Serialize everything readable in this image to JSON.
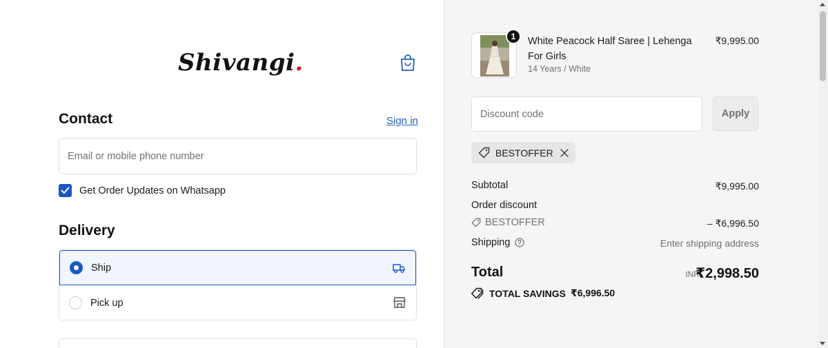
{
  "brand": {
    "name": "Shivangi"
  },
  "contact": {
    "title": "Contact",
    "signin_label": "Sign in",
    "email_placeholder": "Email or mobile phone number",
    "whatsapp_label": "Get Order Updates on Whatsapp",
    "whatsapp_checked": true
  },
  "delivery": {
    "title": "Delivery",
    "options": [
      {
        "label": "Ship",
        "selected": true,
        "icon": "truck-icon"
      },
      {
        "label": "Pick up",
        "selected": false,
        "icon": "store-icon"
      }
    ]
  },
  "cart": {
    "item": {
      "name": "White Peacock Half Saree | Lehenga For Girls",
      "variant": "14 Years / White",
      "price": "₹9,995.00",
      "quantity": "1"
    },
    "discount_placeholder": "Discount code",
    "apply_label": "Apply",
    "applied_code": "BESTOFFER"
  },
  "summary": {
    "subtotal_label": "Subtotal",
    "subtotal_value": "₹9,995.00",
    "order_discount_label": "Order discount",
    "discount_code": "BESTOFFER",
    "discount_value": "– ₹6,996.50",
    "shipping_label": "Shipping",
    "shipping_value": "Enter shipping address",
    "total_label": "Total",
    "currency": "INR",
    "total_value": "₹2,998.50",
    "savings_label": "TOTAL SAVINGS",
    "savings_value": "₹6,996.50"
  },
  "colors": {
    "accent": "#1859c4",
    "link": "#1f5fbf",
    "logo_red": "#c8202b",
    "logo_gold": "#e8a317"
  }
}
